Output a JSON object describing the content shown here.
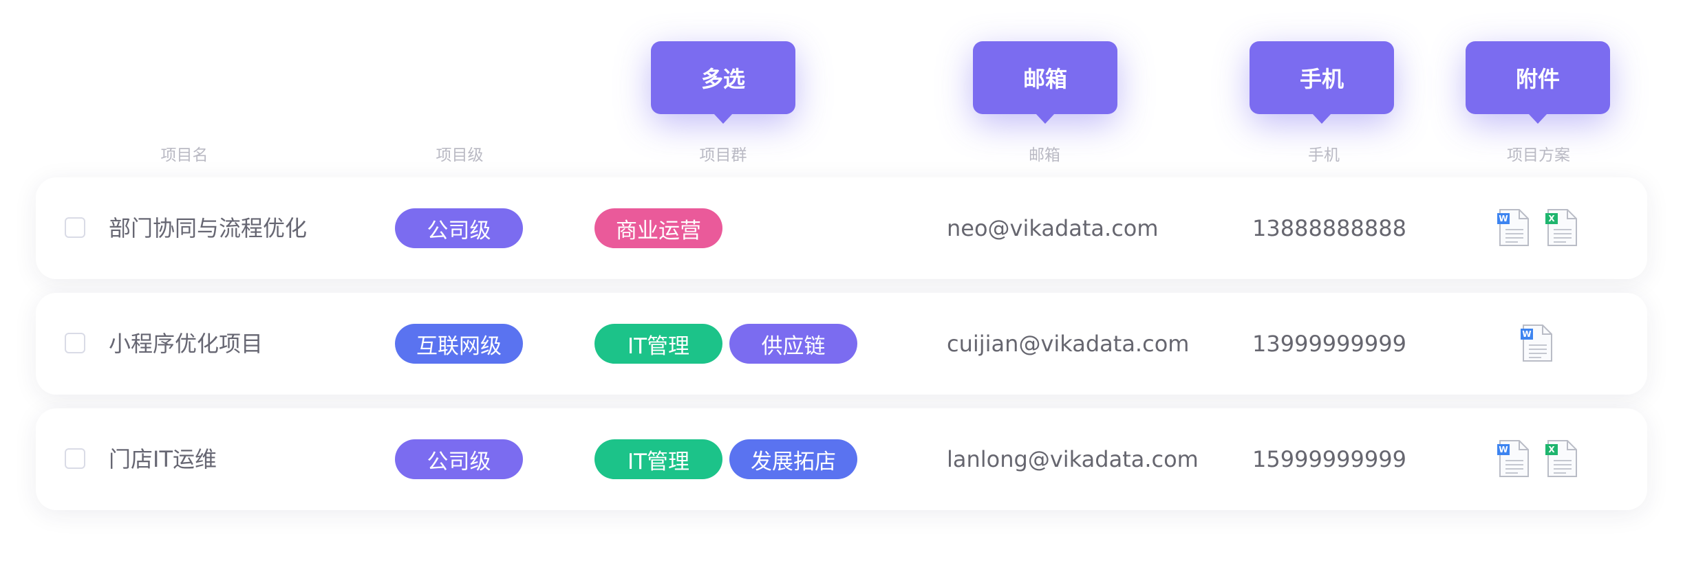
{
  "callouts": {
    "multi_select": "多选",
    "email": "邮箱",
    "phone": "手机",
    "attachment": "附件"
  },
  "columns": {
    "name": "项目名",
    "level": "项目级",
    "group": "项目群",
    "email": "邮箱",
    "phone": "手机",
    "plan": "项目方案"
  },
  "rows": [
    {
      "name": "部门协同与流程优化",
      "level": "公司级",
      "tags": [
        "商业运营"
      ],
      "email": "neo@vikadata.com",
      "phone": "13888888888",
      "attachments": [
        "word",
        "excel"
      ]
    },
    {
      "name": "小程序优化项目",
      "level": "互联网级",
      "tags": [
        "IT管理",
        "供应链"
      ],
      "email": "cuijian@vikadata.com",
      "phone": "13999999999",
      "attachments": [
        "word"
      ]
    },
    {
      "name": "门店IT运维",
      "level": "公司级",
      "tags": [
        "IT管理",
        "发展拓店"
      ],
      "email": "lanlong@vikadata.com",
      "phone": "15999999999",
      "attachments": [
        "word",
        "excel"
      ]
    }
  ],
  "colors": {
    "accent": "#7b6cf0",
    "level_company": "#7b6cf0",
    "level_internet": "#5a73f0",
    "tag_business_ops": "#ea5a9a",
    "tag_it_management": "#1cc389",
    "tag_supply_chain": "#7b6cf0",
    "tag_expansion": "#5a73f0"
  }
}
